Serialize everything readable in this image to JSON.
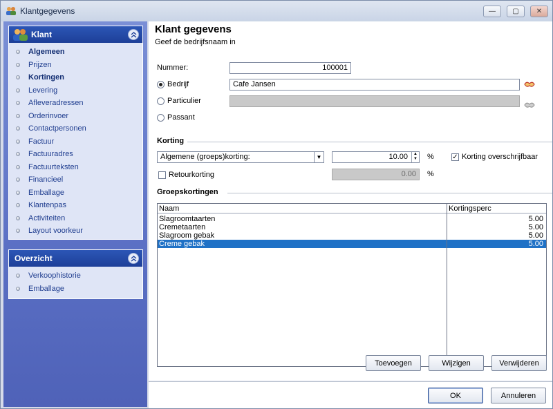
{
  "window": {
    "title": "Klantgegevens"
  },
  "nav": {
    "klant": {
      "title": "Klant",
      "items": [
        {
          "label": "Algemeen",
          "bold": true
        },
        {
          "label": "Prijzen",
          "bold": false
        },
        {
          "label": "Kortingen",
          "bold": true
        },
        {
          "label": "Levering",
          "bold": false
        },
        {
          "label": "Afleveradressen",
          "bold": false
        },
        {
          "label": "Orderinvoer",
          "bold": false
        },
        {
          "label": "Contactpersonen",
          "bold": false
        },
        {
          "label": "Factuur",
          "bold": false
        },
        {
          "label": "Factuuradres",
          "bold": false
        },
        {
          "label": "Factuurteksten",
          "bold": false
        },
        {
          "label": "Financieel",
          "bold": false
        },
        {
          "label": "Emballage",
          "bold": false
        },
        {
          "label": "Klantenpas",
          "bold": false
        },
        {
          "label": "Activiteiten",
          "bold": false
        },
        {
          "label": "Layout voorkeur",
          "bold": false
        }
      ]
    },
    "overzicht": {
      "title": "Overzicht",
      "items": [
        {
          "label": "Verkoophistorie"
        },
        {
          "label": "Emballage"
        }
      ]
    }
  },
  "header": {
    "title": "Klant gegevens",
    "subtitle": "Geef de bedrijfsnaam in"
  },
  "form": {
    "nummer_label": "Nummer:",
    "nummer_value": "100001",
    "bedrijf_label": "Bedrijf",
    "bedrijf_value": "Cafe Jansen",
    "particulier_label": "Particulier",
    "passant_label": "Passant"
  },
  "korting": {
    "section": "Korting",
    "type_value": "Algemene (groeps)korting:",
    "percentage_value": "10.00",
    "percent_sign": "%",
    "overschrijf_label": "Korting overschrijfbaar",
    "retour_label": "Retourkorting",
    "retour_value": "0.00",
    "retour_percent_sign": "%"
  },
  "groepskortingen": {
    "section": "Groepskortingen",
    "columns": [
      "Naam",
      "Kortingsperc"
    ],
    "rows": [
      {
        "naam": "Slagroomtaarten",
        "perc": "5.00"
      },
      {
        "naam": "Cremetaarten",
        "perc": "5.00"
      },
      {
        "naam": "Slagroom gebak",
        "perc": "5.00"
      },
      {
        "naam": "Creme gebak",
        "perc": "5.00"
      }
    ]
  },
  "buttons": {
    "toevoegen": "Toevoegen",
    "wijzigen": "Wijzigen",
    "verwijderen": "Verwijderen",
    "ok": "OK",
    "annuleren": "Annuleren"
  }
}
